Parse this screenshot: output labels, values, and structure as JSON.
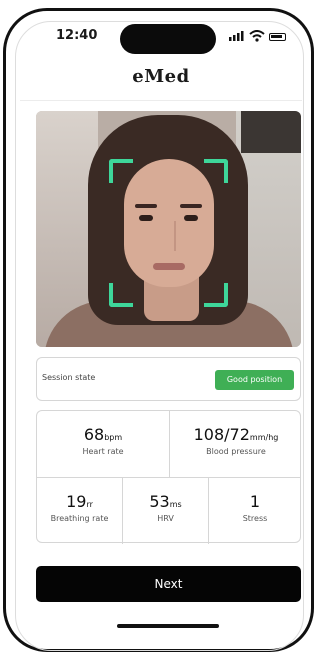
{
  "status_bar": {
    "time": "12:40"
  },
  "header": {
    "logo": "eMed"
  },
  "session": {
    "label": "Session state",
    "status": "Good position",
    "status_color": "#3faf55"
  },
  "metrics": {
    "heart_rate": {
      "value": "68",
      "unit": "bpm",
      "label": "Heart rate"
    },
    "blood_pressure": {
      "value": "108/72",
      "unit": "mm/hg",
      "label": "Blood pressure"
    },
    "breathing_rate": {
      "value": "19",
      "unit": "rr",
      "label": "Breathing rate"
    },
    "hrv": {
      "value": "53",
      "unit": "ms",
      "label": "HRV"
    },
    "stress": {
      "value": "1",
      "unit": "",
      "label": "Stress"
    }
  },
  "actions": {
    "next_label": "Next"
  },
  "colors": {
    "accent": "#3ed69a",
    "button": "#050505"
  },
  "icons": [
    "signal-icon",
    "wifi-icon",
    "battery-icon",
    "face-frame-icon"
  ]
}
